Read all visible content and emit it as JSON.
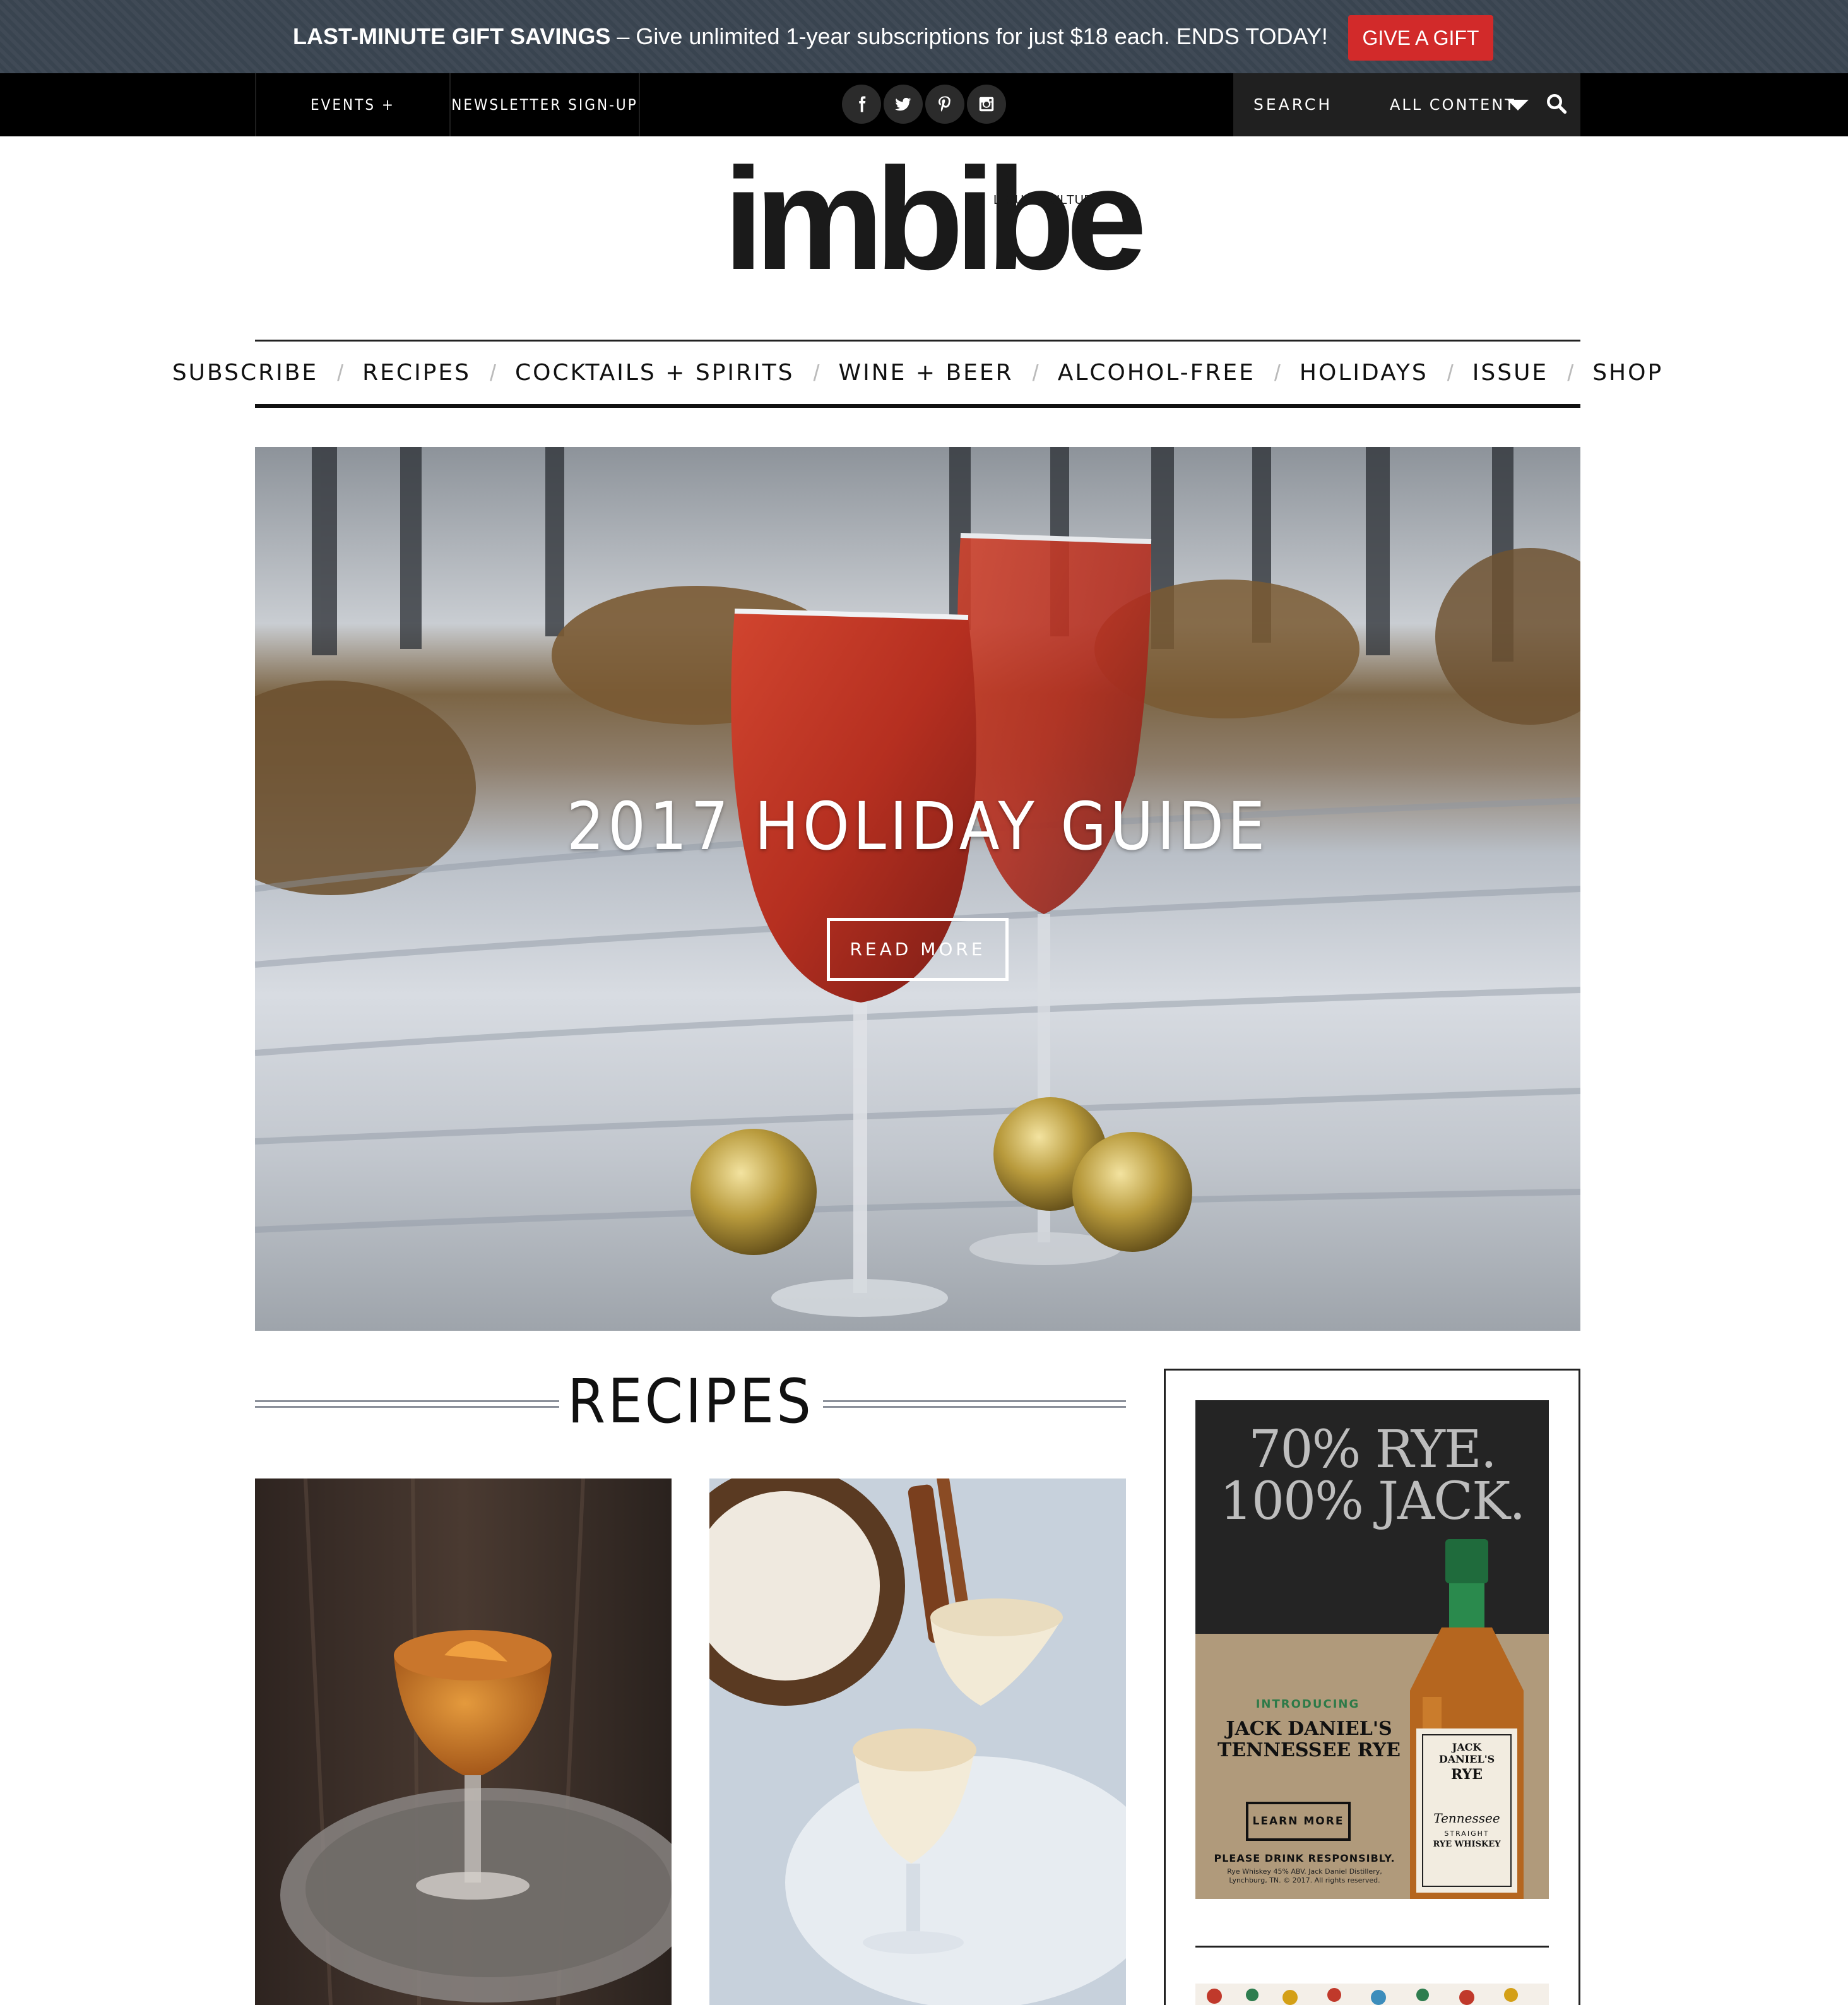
{
  "promo": {
    "headline": "LAST-MINUTE GIFT SAVINGS",
    "message": " – Give unlimited 1-year subscriptions for just $18 each. ENDS TODAY!",
    "button": "GIVE A GIFT",
    "button_color": "#d22a2a"
  },
  "utility": {
    "links": [
      "EVENTS + PROMOTIONS",
      "NEWSLETTER SIGN-UP"
    ],
    "social": [
      "facebook-icon",
      "twitter-icon",
      "pinterest-icon",
      "instagram-icon"
    ],
    "search_label": "SEARCH",
    "filter_value": "ALL CONTENT"
  },
  "logo": {
    "word": "imbibe",
    "tagline": "LIQUID CULTURE"
  },
  "nav": [
    "SUBSCRIBE",
    "RECIPES",
    "COCKTAILS + SPIRITS",
    "WINE + BEER",
    "ALCOHOL-FREE",
    "HOLIDAYS",
    "ISSUE",
    "SHOP"
  ],
  "hero": {
    "title": "2017 HOLIDAY GUIDE",
    "button": "READ MORE"
  },
  "recipes": {
    "heading": "RECIPES"
  },
  "ad": {
    "headline_1": "70% RYE.",
    "headline_2": "100% JACK.",
    "intro": "INTRODUCING",
    "product_1": "JACK DANIEL'S",
    "product_2": "TENNESSEE RYE",
    "learn_more": "LEARN MORE",
    "responsibility": "PLEASE DRINK RESPONSIBLY.",
    "fine_1": "Rye Whiskey 45% ABV. Jack Daniel Distillery,",
    "fine_2": "Lynchburg, TN. © 2017. All rights reserved.",
    "label_brand": "JACK DANIEL'S",
    "label_rye": "RYE",
    "label_script": "Tennessee",
    "label_straight": "STRAIGHT",
    "label_type": "RYE WHISKEY"
  }
}
